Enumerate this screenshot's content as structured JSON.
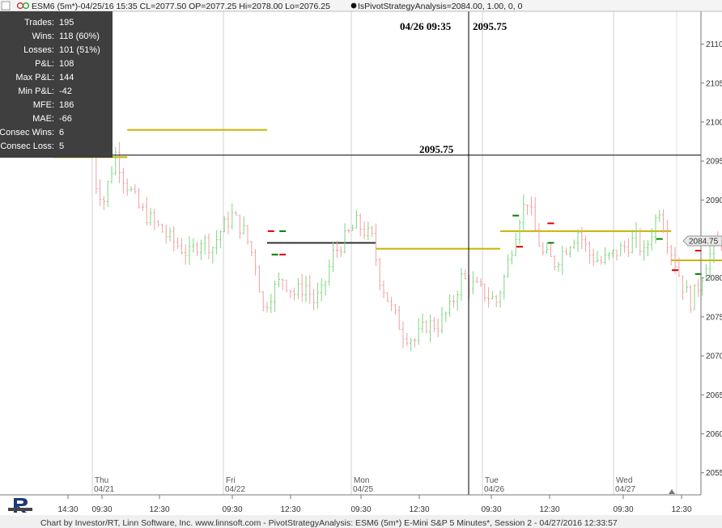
{
  "header": {
    "symbol_text": "ESM6 (5m*)-04/25/16 15:35 CL=2077.50 OP=2077.25 Hi=2078.00 Lo=2076.25",
    "indicator_text": "IsPivotStrategyAnalysis=2084.00, 1.00, 0, 0"
  },
  "crosshair": {
    "time_label": "04/26 09:35",
    "price_label": "2095.75",
    "price_value": 2095.75,
    "line_label": "2095.75"
  },
  "stats": {
    "rows": [
      {
        "label": "Trades:",
        "value": "195"
      },
      {
        "label": "Wins:",
        "value": "118 (60%)"
      },
      {
        "label": "Losses:",
        "value": "101 (51%)"
      },
      {
        "label": "P&L:",
        "value": "108"
      },
      {
        "label": "Max P&L:",
        "value": "144"
      },
      {
        "label": "Min P&L:",
        "value": "-42"
      },
      {
        "label": "MFE:",
        "value": "186"
      },
      {
        "label": "MAE:",
        "value": "-66"
      },
      {
        "label": "Consec Wins:",
        "value": "6"
      },
      {
        "label": "Consec Loss:",
        "value": "5"
      }
    ]
  },
  "last_price_tag": "2084.75",
  "footer": {
    "text": "Chart by Investor/RT, Linn Software, Inc. www.linnsoft.com - PivotStrategyAnalysis: ESM6 (5m*) E-Mini S&P 5 Minutes*, Session 2 - 04/27/2016 12:33:57"
  },
  "colors": {
    "up_bar": "#7fd67f",
    "down_bar": "#f0a0a0",
    "pivot_line": "#c8b400",
    "stats_bg": "#3f3f3f",
    "buy_marker": "#008000",
    "sell_marker": "#e00000"
  },
  "chart_data": {
    "type": "bar",
    "subtype": "ohlc-price-bars",
    "ylim": [
      2053,
      2114
    ],
    "y_ticks": [
      2055,
      2060,
      2065,
      2070,
      2075,
      2080,
      2085,
      2090,
      2095,
      2100,
      2105,
      2110
    ],
    "y_tick_labels": [
      "2055",
      "2060",
      "2065",
      "2070",
      "2075",
      "2080",
      "2085",
      "2090",
      "2095",
      "2100",
      "2105",
      "2110"
    ],
    "x_tick_labels": [
      "14:30",
      "09:30",
      "12:30",
      "09:30",
      "12:30",
      "09:30",
      "12:30",
      "09:30",
      "12:30",
      "09:30",
      "12:30"
    ],
    "day_labels": [
      {
        "day": "Thu",
        "date": "04/21"
      },
      {
        "day": "Fri",
        "date": "04/22"
      },
      {
        "day": "Mon",
        "date": "04/25"
      },
      {
        "day": "Tue",
        "date": "04/26"
      },
      {
        "day": "Wed",
        "date": "04/27"
      }
    ],
    "price_path": [
      [
        0,
        2096
      ],
      [
        1,
        2092
      ],
      [
        3,
        2090
      ],
      [
        6,
        2096
      ],
      [
        8,
        2093
      ],
      [
        12,
        2089
      ],
      [
        16,
        2087
      ],
      [
        20,
        2085
      ],
      [
        25,
        2083
      ],
      [
        28,
        2085
      ],
      [
        31,
        2084
      ],
      [
        33,
        2086
      ],
      [
        36,
        2088
      ],
      [
        39,
        2086
      ],
      [
        42,
        2082
      ],
      [
        44,
        2076
      ],
      [
        46,
        2078
      ],
      [
        49,
        2080
      ],
      [
        52,
        2078
      ],
      [
        55,
        2079
      ],
      [
        57,
        2077
      ],
      [
        59,
        2078
      ],
      [
        62,
        2083
      ],
      [
        65,
        2085
      ],
      [
        68,
        2087
      ],
      [
        70,
        2086
      ],
      [
        72,
        2085
      ],
      [
        74,
        2080
      ],
      [
        77,
        2076
      ],
      [
        80,
        2073
      ],
      [
        83,
        2072
      ],
      [
        86,
        2074
      ],
      [
        89,
        2074
      ],
      [
        92,
        2076
      ],
      [
        95,
        2080
      ],
      [
        98,
        2079
      ],
      [
        101,
        2078
      ],
      [
        104,
        2077
      ],
      [
        106,
        2080
      ],
      [
        108,
        2084
      ],
      [
        110,
        2088
      ],
      [
        112,
        2090
      ],
      [
        114,
        2086
      ],
      [
        116,
        2083
      ],
      [
        119,
        2082
      ],
      [
        122,
        2084
      ],
      [
        125,
        2086
      ],
      [
        128,
        2083
      ],
      [
        131,
        2082
      ],
      [
        134,
        2083
      ],
      [
        137,
        2084
      ],
      [
        140,
        2085
      ],
      [
        142,
        2083
      ],
      [
        144,
        2086
      ],
      [
        146,
        2089
      ],
      [
        148,
        2085
      ],
      [
        150,
        2082
      ],
      [
        152,
        2079
      ],
      [
        154,
        2077
      ],
      [
        156,
        2079
      ],
      [
        158,
        2082
      ],
      [
        160,
        2084
      ],
      [
        162,
        2085
      ]
    ],
    "pivot_segments": [
      {
        "price": 2099,
        "from_bar": 9,
        "to_bar": 45,
        "color": "#c8b400"
      },
      {
        "price": 2095.5,
        "from_bar": -10,
        "to_bar": 9,
        "color": "#c8b400"
      },
      {
        "price": 2084.5,
        "from_bar": 45,
        "to_bar": 73,
        "color": "#333333"
      },
      {
        "price": 2083.75,
        "from_bar": 73,
        "to_bar": 105,
        "color": "#c8b400"
      },
      {
        "price": 2086,
        "from_bar": 105,
        "to_bar": 149,
        "color": "#c8b400"
      },
      {
        "price": 2082.25,
        "from_bar": 149,
        "to_bar": 163,
        "color": "#c8b400"
      }
    ],
    "trade_markers": [
      {
        "bar": 46,
        "price": 2086,
        "kind": "sell"
      },
      {
        "bar": 47,
        "price": 2083,
        "kind": "buy"
      },
      {
        "bar": 49,
        "price": 2086,
        "kind": "buy"
      },
      {
        "bar": 49,
        "price": 2083,
        "kind": "sell"
      },
      {
        "bar": 109,
        "price": 2088,
        "kind": "buy"
      },
      {
        "bar": 110,
        "price": 2084,
        "kind": "sell"
      },
      {
        "bar": 118,
        "price": 2087,
        "kind": "sell"
      },
      {
        "bar": 118,
        "price": 2084.5,
        "kind": "buy"
      },
      {
        "bar": 146,
        "price": 2085,
        "kind": "buy"
      },
      {
        "bar": 150,
        "price": 2081,
        "kind": "sell"
      },
      {
        "bar": 156,
        "price": 2083.5,
        "kind": "sell"
      },
      {
        "bar": 156,
        "price": 2080.5,
        "kind": "buy"
      }
    ]
  }
}
